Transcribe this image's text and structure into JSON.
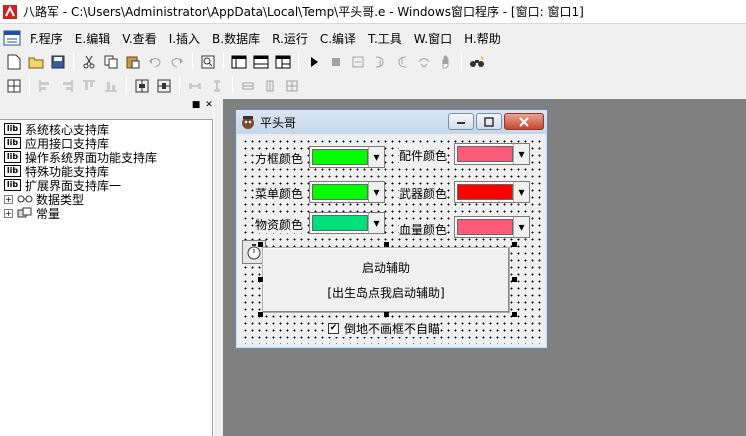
{
  "window": {
    "title": "八路军 - C:\\Users\\Administrator\\AppData\\Local\\Temp\\平头哥.e - Windows窗口程序 - [窗口: 窗口1]"
  },
  "menu": [
    "F.程序",
    "E.编辑",
    "V.查看",
    "I.插入",
    "B.数据库",
    "R.运行",
    "C.编译",
    "T.工具",
    "W.窗口",
    "H.帮助"
  ],
  "toolbar1": [
    "new-icon",
    "open-icon",
    "save-icon",
    "cut-icon",
    "copy-icon",
    "paste-icon",
    "undo-icon",
    "redo-icon",
    "find-icon",
    "layout-1-icon",
    "layout-2-icon",
    "layout-3-icon",
    "run-icon",
    "stop-icon",
    "step-icon",
    "step-into-icon",
    "step-out-icon",
    "run-to-cursor-icon",
    "hand-icon",
    "binoculars-icon"
  ],
  "toolbar2": [
    "grid-icon",
    "align-left-icon",
    "align-right-icon",
    "align-top-icon",
    "align-bottom-icon",
    "center-h-icon",
    "center-v-icon",
    "space-h-icon",
    "space-v-icon",
    "same-width-icon",
    "same-height-icon",
    "same-size-icon"
  ],
  "tree": {
    "libs": [
      "系统核心支持库",
      "应用接口支持库",
      "操作系统界面功能支持库",
      "特殊功能支持库",
      "扩展界面支持库一"
    ],
    "nodes": [
      "数据类型",
      "常量"
    ]
  },
  "form": {
    "title": "平头哥",
    "rows": [
      {
        "label": "方框颜色",
        "color": "#00ff00"
      },
      {
        "label": "配件颜色",
        "color": "#ff5a78"
      },
      {
        "label": "菜单颜色",
        "color": "#00ff00"
      },
      {
        "label": "武器颜色",
        "color": "#ff0000"
      },
      {
        "label": "物资颜色",
        "color": "#00e07a"
      },
      {
        "label": "血量颜色",
        "color": "#ff5a78"
      }
    ],
    "button_line1": "启动辅助",
    "button_line2": "[出生岛点我启动辅助]",
    "checkbox_label": "倒地不画框不自瞄",
    "checkbox_checked": true
  }
}
